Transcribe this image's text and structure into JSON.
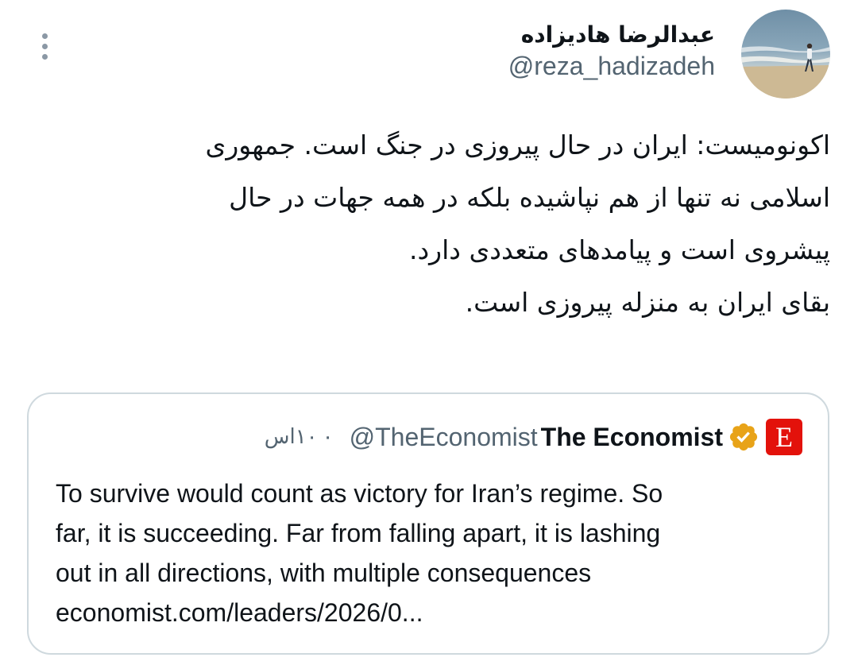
{
  "tweet": {
    "author": {
      "display_name": "عبدالرضا هادیزاده",
      "handle": "@reza_hadizadeh",
      "avatar_icon": "profile-photo-beach"
    },
    "more_icon": "more-vertical-icon",
    "text_lines": [
      "اکونومیست: ایران در حال پیروزی در جنگ است. جمهوری",
      "اسلامی نه تنها از هم نپاشیده بلکه در همه جهات در حال",
      "پیشروی است و پیامدهای متعددی دارد.",
      "بقای ایران به منزله پیروزی است."
    ]
  },
  "quote": {
    "logo_letter": "E",
    "logo_color": "#e3120b",
    "name": "The Economist",
    "verified_icon": "verified-gold-badge-icon",
    "handle": "@TheEconomist",
    "separator": "·",
    "time": "۱۰اس",
    "text_lines": [
      "To survive would count as victory for Iran’s regime. So",
      "far, it is succeeding. Far from falling apart, it is lashing",
      "out in all directions, with multiple consequences",
      "economist.com/leaders/2026/0..."
    ]
  },
  "colors": {
    "text_primary": "#0f1419",
    "text_secondary": "#536471",
    "border": "#cfd9de",
    "verified_gold": "#e8a318"
  }
}
